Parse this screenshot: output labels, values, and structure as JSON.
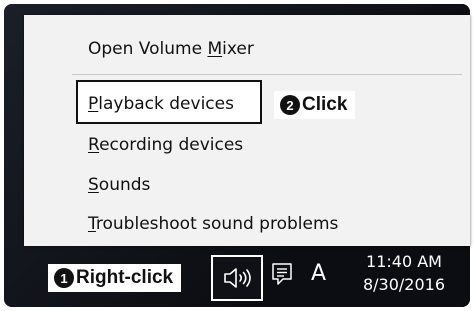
{
  "context_menu": {
    "items": [
      {
        "before": "Open Volume ",
        "accel": "M",
        "after": "ixer"
      },
      {
        "before": "",
        "accel": "P",
        "after": "layback devices"
      },
      {
        "before": "",
        "accel": "R",
        "after": "ecording devices"
      },
      {
        "before": "",
        "accel": "S",
        "after": "ounds"
      },
      {
        "before": "",
        "accel": "T",
        "after": "roubleshoot sound problems"
      }
    ]
  },
  "callouts": {
    "click": {
      "number": "❷",
      "label": "Click"
    },
    "right_click": {
      "number": "❶",
      "label": "Right-click"
    }
  },
  "taskbar": {
    "speaker_icon": "speaker-volume-icon",
    "notification_icon": "action-center-icon",
    "ime_indicator": "A",
    "time": "11:40 AM",
    "date": "8/30/2016"
  },
  "colors": {
    "taskbar_bg": "#11131a",
    "menu_bg": "#f2f2f2",
    "highlight_border": "#111111"
  }
}
